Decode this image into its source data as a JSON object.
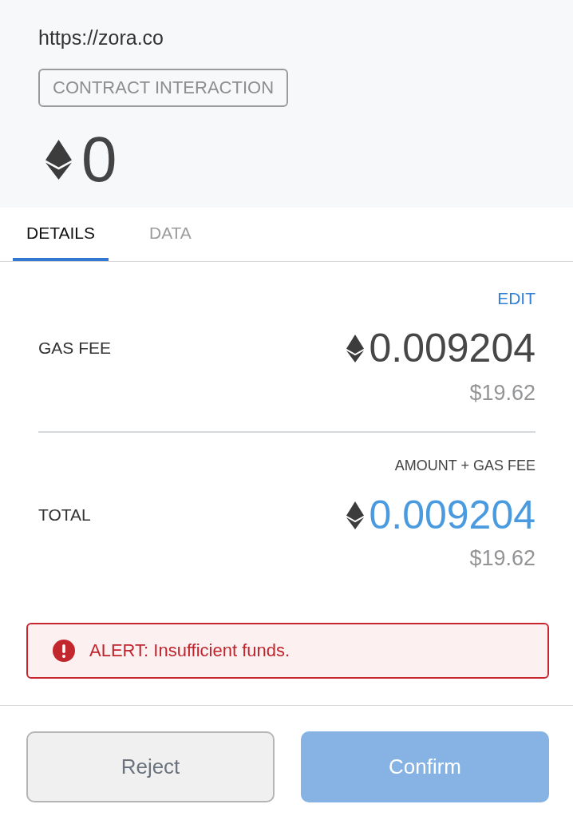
{
  "origin": "https://zora.co",
  "badge": "CONTRACT INTERACTION",
  "amount": "0",
  "tabs": [
    {
      "label": "DETAILS",
      "selected": true
    },
    {
      "label": "DATA",
      "selected": false
    }
  ],
  "rows": [
    {
      "kind": "fee",
      "action": "EDIT",
      "label": "GAS FEE",
      "value": "0.009204",
      "fiat": "$19.62"
    },
    {
      "kind": "total",
      "caption": "AMOUNT + GAS FEE",
      "label": "TOTAL",
      "value": "0.009204",
      "fiat": "$19.62"
    }
  ],
  "alert": {
    "text": "ALERT: Insufficient funds."
  },
  "buttons": [
    {
      "label": "Reject",
      "kind": "secondary",
      "disabled": false
    },
    {
      "label": "Confirm",
      "kind": "primary",
      "disabled": true
    }
  ]
}
